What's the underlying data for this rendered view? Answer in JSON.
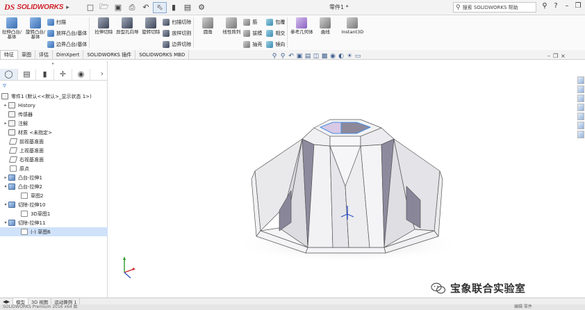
{
  "app": {
    "logo_ds": "DS",
    "logo_text": "SOLIDWORKS",
    "doc_title": "零件1 *",
    "help_search_placeholder": "搜索 SOLIDWORKS 帮助",
    "icons": [
      "new-icon",
      "open-icon",
      "save-icon",
      "print-icon",
      "undo-icon",
      "select-icon",
      "rebuild-icon",
      "options-icon"
    ]
  },
  "ribbon": {
    "big1": "拉伸凸台/基体",
    "big2": "旋转凸台/基体",
    "sweep": "扫描",
    "loft": "放样凸台/基体",
    "boundary": "边界凸台/基体",
    "cut_extrude": "拉伸切除",
    "hole_wizard": "异型孔向导",
    "cut_revolve": "旋转切除",
    "cut_sweep": "扫描切除",
    "cut_loft": "放样切割",
    "cut_boundary": "边界切除",
    "fillet": "圆角",
    "linear_pattern": "线性阵列",
    "rib": "筋",
    "draft": "拔模",
    "shell": "抽壳",
    "wrap": "包覆",
    "intersect": "相交",
    "mirror": "镜向",
    "ref_geometry": "参考几何体",
    "curves": "曲线",
    "instant3d": "Instant3D"
  },
  "cm_tabs": [
    "特征",
    "草图",
    "评估",
    "DimXpert",
    "SOLIDWORKS 插件",
    "SOLIDWORKS MBD"
  ],
  "feature_tree": {
    "root": "零件1  (默认<<默认>_显示状态 1>)",
    "items": [
      {
        "label": "History",
        "icon": "history-icon"
      },
      {
        "label": "传感器",
        "icon": "sensor-icon"
      },
      {
        "label": "注解",
        "icon": "annotation-icon"
      },
      {
        "label": "材质 <未指定>",
        "icon": "material-icon"
      },
      {
        "label": "前视基准面",
        "icon": "plane-icon"
      },
      {
        "label": "上视基准面",
        "icon": "plane-icon"
      },
      {
        "label": "右视基准面",
        "icon": "plane-icon"
      },
      {
        "label": "原点",
        "icon": "origin-icon"
      },
      {
        "label": "凸台-拉伸1",
        "icon": "extrude-icon"
      },
      {
        "label": "凸台-拉伸2",
        "icon": "extrude-icon"
      },
      {
        "label": "草图2",
        "icon": "sketch-icon"
      },
      {
        "label": "切除-拉伸10",
        "icon": "cut-icon"
      },
      {
        "label": "3D草图1",
        "icon": "3dsketch-icon"
      },
      {
        "label": "切除-拉伸11",
        "icon": "cut-icon"
      },
      {
        "label": "(-) 草图6",
        "icon": "sketch-icon"
      }
    ]
  },
  "bottom_tabs": [
    "模型",
    "3D 视图",
    "运动算例 1"
  ],
  "status": {
    "left": "SOLIDWORKS Premium 2016 x64 版",
    "right": "编辑 零件"
  },
  "watermark": "宝象联合实验室",
  "colors": {
    "accent": "#3a6fb3",
    "brand_red": "#d0202a",
    "selection": "#cfe2fa",
    "model_face_light": "#f4f4f6",
    "model_face_dark": "#8e8a9e",
    "highlight_edge": "#4a8fe0"
  }
}
